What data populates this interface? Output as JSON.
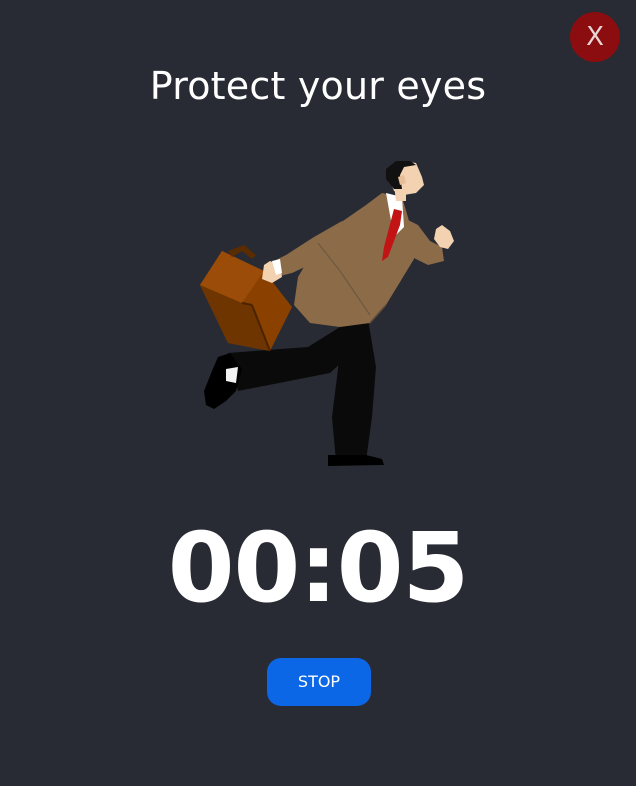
{
  "close_button": {
    "label": "X"
  },
  "title": "Protect your eyes",
  "timer": {
    "display": "00:05"
  },
  "stop_button": {
    "label": "STOP"
  },
  "illustration": {
    "icon": "running-businessman-illustration"
  },
  "colors": {
    "background": "#282b34",
    "close_button": "#8b0d0f",
    "stop_button": "#0c67e6",
    "text": "#ffffff"
  }
}
